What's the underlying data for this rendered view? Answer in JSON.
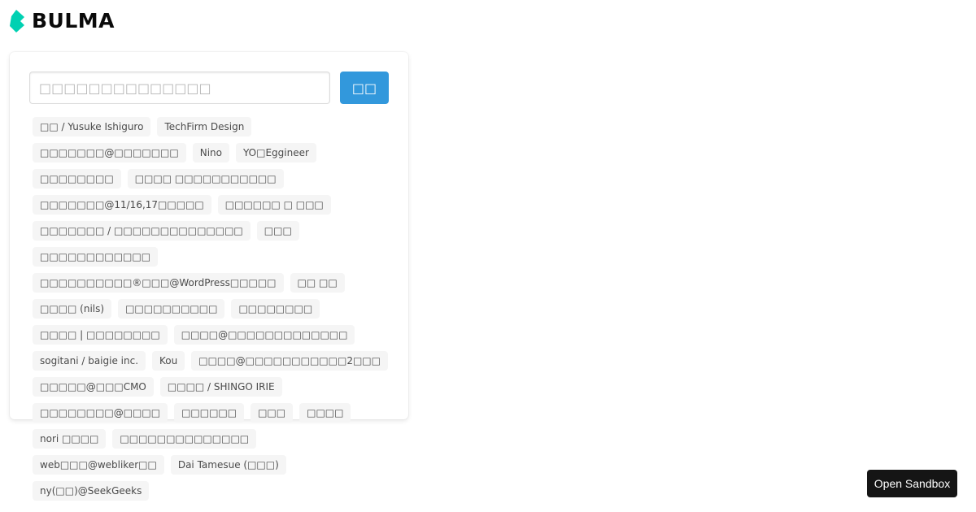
{
  "logo": {
    "text": "BULMA",
    "accent_color": "#00d1b2"
  },
  "search": {
    "placeholder": "□□□□□□□□□□□□□□",
    "button_label": "□□"
  },
  "tags": [
    "□□ / Yusuke Ishiguro",
    "TechFirm Design",
    "□□□□□□□@□□□□□□□",
    "Nino",
    "YO□Eggineer",
    "□□□□□□□□",
    "□□□□ □□□□□□□□□□□",
    "□□□□□□□@11/16,17□□□□□",
    "□□□□□□ □ □□□",
    "□□□□□□□ / □□□□□□□□□□□□□□",
    "□□□",
    "□□□□□□□□□□□□",
    "□□□□□□□□□□®□□□@WordPress□□□□□",
    "□□ □□",
    "□□□□ (nils)",
    "□□□□□□□□□□",
    "□□□□□□□□",
    "□□□□ | □□□□□□□□",
    "□□□□@□□□□□□□□□□□□□",
    "sogitani / baigie inc.",
    "Kou",
    "□□□□@□□□□□□□□□□□2□□□",
    "□□□□□@□□□CMO",
    "□□□□ / SHINGO IRIE",
    "□□□□□□□□@□□□□",
    "□□□□□□",
    "□□□",
    "□□□□",
    "nori □□□□",
    "□□□□□□□□□□□□□□",
    "web□□□@webliker□□",
    "Dai Tamesue (□□□)",
    "ny(□□)@SeekGeeks"
  ],
  "sandbox": {
    "label": "Open Sandbox"
  }
}
